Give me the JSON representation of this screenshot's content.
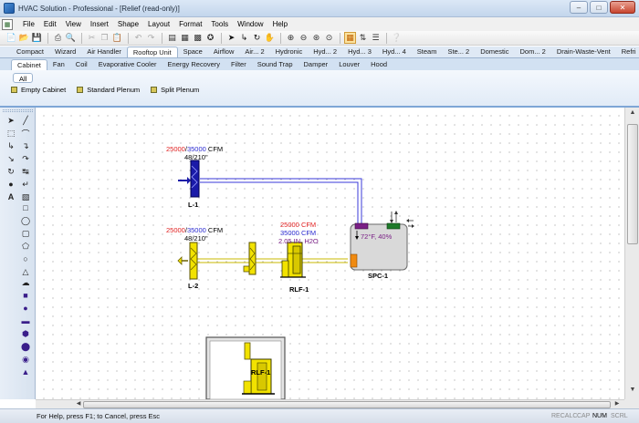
{
  "window": {
    "title": "HVAC Solution - Professional - [Relief (read-only)]"
  },
  "menu": {
    "items": [
      "File",
      "Edit",
      "View",
      "Insert",
      "Shape",
      "Layout",
      "Format",
      "Tools",
      "Window",
      "Help"
    ]
  },
  "category_tabs": [
    "Compact",
    "Wizard",
    "Air Handler",
    "Rooftop Unit",
    "Space",
    "Airflow",
    "Air... 2",
    "Hydronic",
    "Hyd... 2",
    "Hyd... 3",
    "Hyd... 4",
    "Steam",
    "Ste... 2",
    "Domestic",
    "Dom... 2",
    "Drain-Waste-Vent",
    "Refri"
  ],
  "category_active": "Rooftop Unit",
  "sub_tabs": [
    "Cabinet",
    "Fan",
    "Coil",
    "Evaporative Cooler",
    "Energy Recovery",
    "Filter",
    "Sound Trap",
    "Damper",
    "Louver",
    "Hood"
  ],
  "sub_active": "Cabinet",
  "ribbon": {
    "all_label": "All",
    "shapes": [
      "Empty Cabinet",
      "Standard Plenum",
      "Split Plenum"
    ]
  },
  "diagram": {
    "l1": {
      "cfm_a": "25000",
      "sep": "/",
      "cfm_b": "35000",
      "unit": " CFM",
      "size": "48/210\"",
      "label": "L-1"
    },
    "l2": {
      "cfm_a": "25000",
      "sep": "/",
      "cfm_b": "35000",
      "unit": " CFM",
      "size": "48/210\"",
      "label": "L-2"
    },
    "rlf": {
      "line1": "25000 CFM",
      "line2": "35000 CFM",
      "line3": "2.05 IN. H2O",
      "label": "RLF-1"
    },
    "spc": {
      "readout": "72°F, 40%",
      "label": "SPC-1"
    },
    "thumb": {
      "label": "RLF-1"
    },
    "colors": {
      "cfm_red": "#e01e1e",
      "cfm_blue": "#2a2ad0",
      "duct_blue": "#3a3ad8",
      "louver_blue": "#1a1aa8",
      "yellow": "#f2e200",
      "spc_purple": "#7a1f86"
    }
  },
  "status": {
    "help": "For Help, press F1; to Cancel, press Esc",
    "indicators": [
      "RECALC",
      "CAP",
      "NUM",
      "SCRL"
    ],
    "active_indicator": "NUM"
  },
  "icons": [
    "app-icon",
    "new-icon",
    "open-icon",
    "save-icon",
    "print-icon",
    "print-preview-icon",
    "cut-icon",
    "copy-icon",
    "paste-icon",
    "undo-icon",
    "redo-icon",
    "pointer-icon",
    "connector-icon",
    "rotate-icon",
    "hand-icon",
    "zoom-in-icon",
    "zoom-out-icon",
    "zoom-fit-icon",
    "grid-icon",
    "help-pointer-icon"
  ]
}
